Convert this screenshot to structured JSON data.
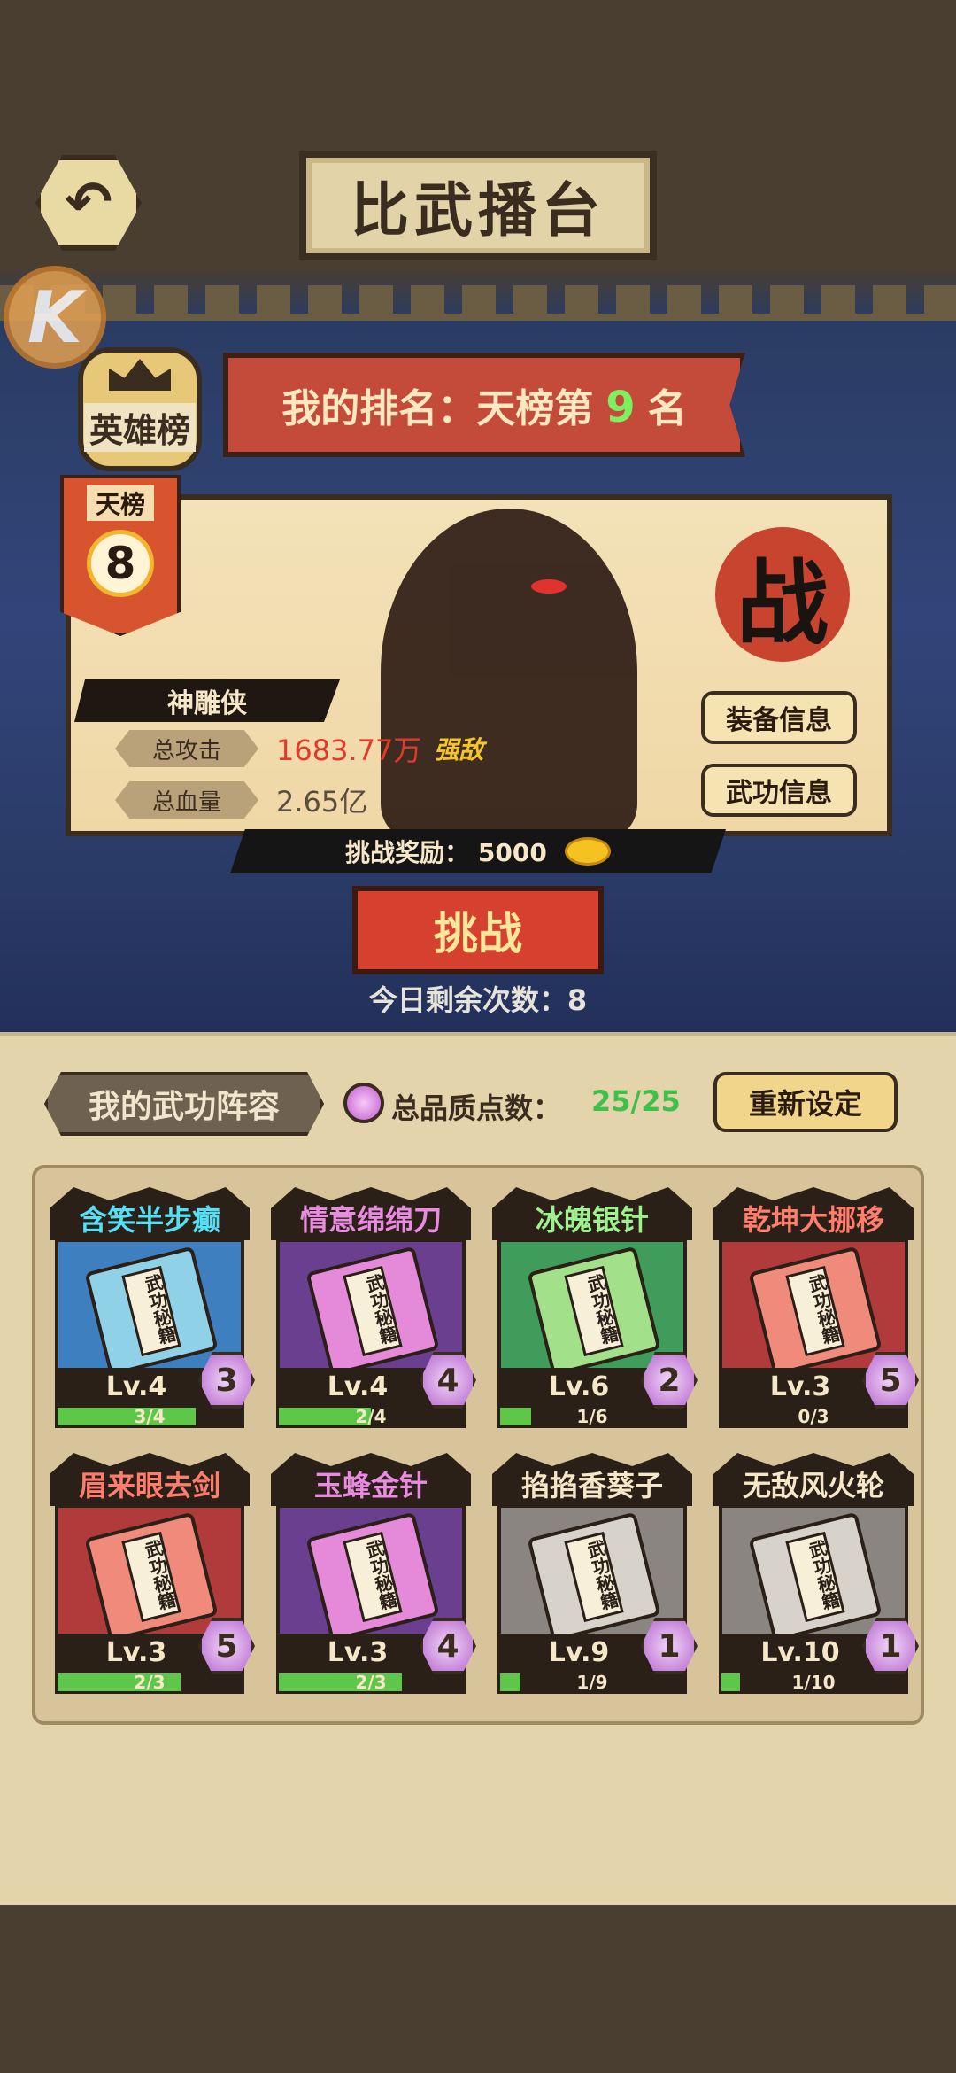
{
  "header": {
    "title": "比武播台",
    "back_icon": "back-arrow-icon",
    "logo_letter": "K"
  },
  "hero_rank_button": {
    "label": "英雄榜"
  },
  "my_rank": {
    "prefix": "我的排名：天榜第",
    "rank": "9",
    "suffix": "名"
  },
  "opponent": {
    "tier_label": "天榜",
    "tier_rank": "8",
    "name": "神雕侠",
    "stamp_text": "战",
    "attack_label": "总攻击",
    "attack_value": "1683.77万",
    "power_tag": "强敌",
    "hp_label": "总血量",
    "hp_value": "2.65亿",
    "equipment_info_label": "装备信息",
    "skill_info_label": "武功信息"
  },
  "reward": {
    "text": "挑战奖励：  5000",
    "icon": "gold-ingot-icon"
  },
  "challenge_button": {
    "label": "挑战"
  },
  "remaining_text": "今日剩余次数：8",
  "lineup": {
    "tab_label": "我的武功阵容",
    "quality_label": "总品质点数：",
    "quality_value": "25/25",
    "reset_label": "重新设定",
    "book_text": "武功秘籍",
    "skills": [
      {
        "name": "含笑半步癫",
        "level": "Lv.4",
        "progress": "3/4",
        "fraction": 0.75,
        "quality": "3",
        "theme": "blue"
      },
      {
        "name": "情意绵绵刀",
        "level": "Lv.4",
        "progress": "2/4",
        "fraction": 0.5,
        "quality": "4",
        "theme": "purple"
      },
      {
        "name": "冰魄银针",
        "level": "Lv.6",
        "progress": "1/6",
        "fraction": 0.1667,
        "quality": "2",
        "theme": "green"
      },
      {
        "name": "乾坤大挪移",
        "level": "Lv.3",
        "progress": "0/3",
        "fraction": 0,
        "quality": "5",
        "theme": "red"
      },
      {
        "name": "眉来眼去剑",
        "level": "Lv.3",
        "progress": "2/3",
        "fraction": 0.6667,
        "quality": "5",
        "theme": "red"
      },
      {
        "name": "玉蜂金针",
        "level": "Lv.3",
        "progress": "2/3",
        "fraction": 0.6667,
        "quality": "4",
        "theme": "purple"
      },
      {
        "name": "掐掐香葵子",
        "level": "Lv.9",
        "progress": "1/9",
        "fraction": 0.1111,
        "quality": "1",
        "theme": "gray"
      },
      {
        "name": "无敌风火轮",
        "level": "Lv.10",
        "progress": "1/10",
        "fraction": 0.1,
        "quality": "1",
        "theme": "gray"
      }
    ]
  },
  "colors": {
    "blue": {
      "bg": "#3d7fbf",
      "book": "#8fd1e6",
      "name": "#56e0f5"
    },
    "purple": {
      "bg": "#6b3f8f",
      "book": "#e58ad8",
      "name": "#e98be0"
    },
    "green": {
      "bg": "#3f9c5a",
      "book": "#a2e08a",
      "name": "#9ff08f"
    },
    "red": {
      "bg": "#b13a3a",
      "book": "#f08a7a",
      "name": "#ff7d6d"
    },
    "gray": {
      "bg": "#8a8580",
      "book": "#d7d3cb",
      "name": "#f5e7c7"
    }
  }
}
